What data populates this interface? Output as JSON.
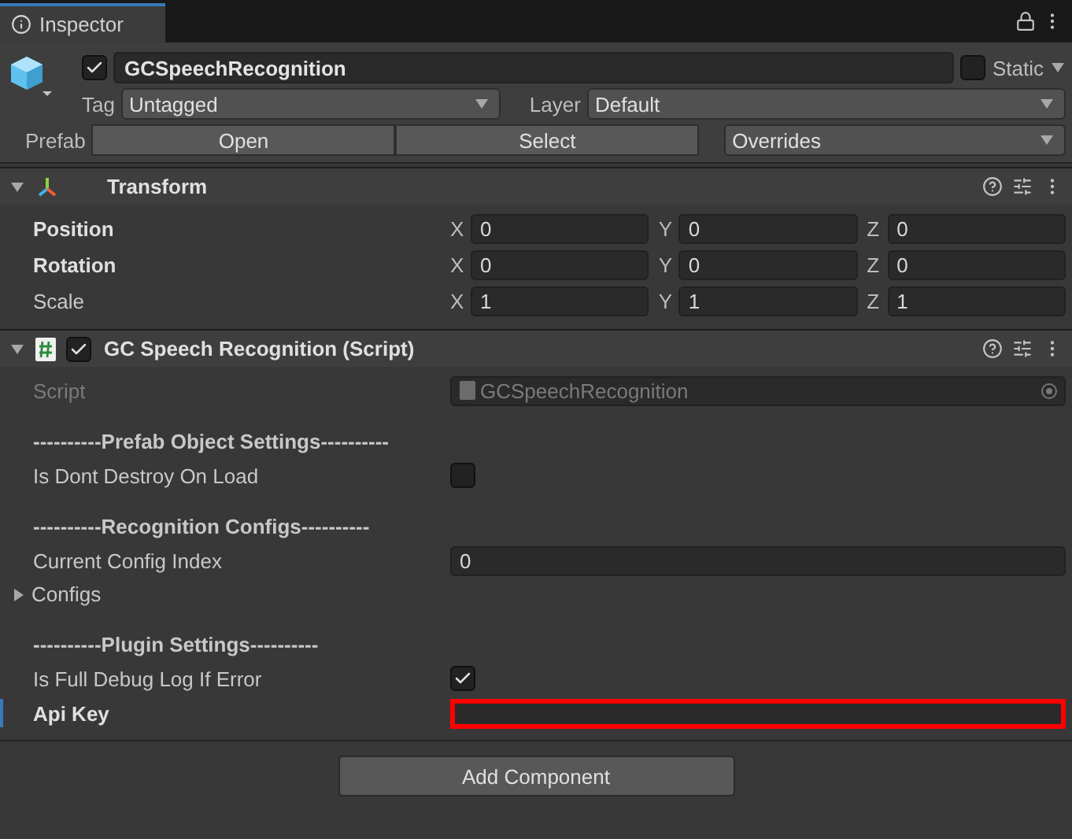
{
  "tab": {
    "title": "Inspector",
    "selected": true
  },
  "game_object": {
    "active": true,
    "name": "GCSpeechRecognition",
    "static": false,
    "static_label": "Static",
    "tag_label": "Tag",
    "tag": "Untagged",
    "layer_label": "Layer",
    "layer": "Default",
    "prefab_label": "Prefab",
    "prefab_buttons": [
      "Open",
      "Select"
    ],
    "overrides": "Overrides"
  },
  "transform": {
    "title": "Transform",
    "expanded": true,
    "rows": [
      {
        "label": "Position",
        "overridden": true,
        "axes": [
          {
            "axis": "X",
            "value": "0"
          },
          {
            "axis": "Y",
            "value": "0"
          },
          {
            "axis": "Z",
            "value": "0"
          }
        ]
      },
      {
        "label": "Rotation",
        "overridden": true,
        "axes": [
          {
            "axis": "X",
            "value": "0"
          },
          {
            "axis": "Y",
            "value": "0"
          },
          {
            "axis": "Z",
            "value": "0"
          }
        ]
      },
      {
        "label": "Scale",
        "overridden": false,
        "axes": [
          {
            "axis": "X",
            "value": "1"
          },
          {
            "axis": "Y",
            "value": "1"
          },
          {
            "axis": "Z",
            "value": "1"
          }
        ]
      }
    ]
  },
  "script_component": {
    "title": "GC Speech Recognition (Script)",
    "enabled": true,
    "expanded": true,
    "properties": [
      {
        "kind": "script",
        "label": "Script",
        "value": "GCSpeechRecognition"
      },
      {
        "kind": "header",
        "label": "----------Prefab Object Settings----------"
      },
      {
        "kind": "checkbox",
        "label": "Is Dont Destroy On Load",
        "checked": false,
        "overridden": false
      },
      {
        "kind": "header",
        "label": "----------Recognition Configs----------"
      },
      {
        "kind": "field",
        "label": "Current Config Index",
        "value": "0",
        "overridden": false,
        "highlighted": false
      },
      {
        "kind": "foldout",
        "label": "Configs",
        "expanded": false
      },
      {
        "kind": "header",
        "label": "----------Plugin Settings----------"
      },
      {
        "kind": "checkbox",
        "label": "Is Full Debug Log If Error",
        "checked": true,
        "overridden": false
      },
      {
        "kind": "field",
        "label": "Api Key",
        "overridden": true,
        "highlighted": true
      }
    ]
  },
  "add_component": "Add Component"
}
